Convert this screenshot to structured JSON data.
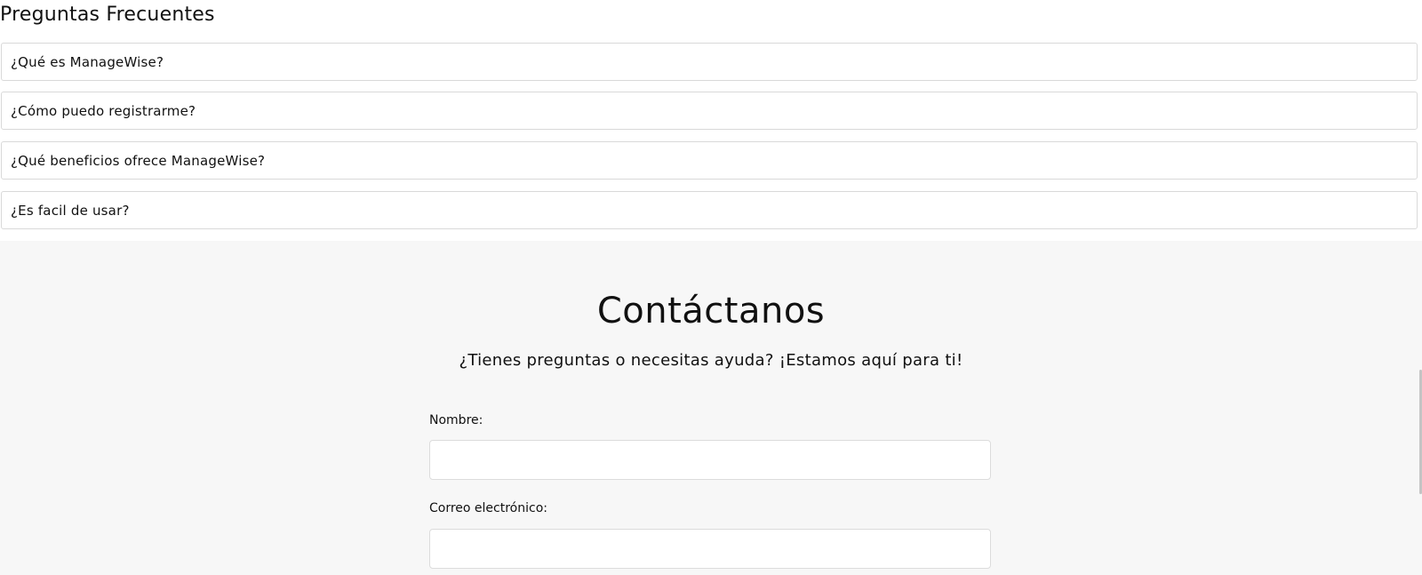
{
  "faq": {
    "title": "Preguntas Frecuentes",
    "items": [
      {
        "question": "¿Qué es ManageWise?"
      },
      {
        "question": "¿Cómo puedo registrarme?"
      },
      {
        "question": "¿Qué beneficios ofrece ManageWise?"
      },
      {
        "question": "¿Es facil de usar?"
      }
    ]
  },
  "contact": {
    "title": "Contáctanos",
    "subtitle": "¿Tienes preguntas o necesitas ayuda? ¡Estamos aquí para ti!",
    "name_label": "Nombre:",
    "name_value": "",
    "email_label": "Correo electrónico:",
    "email_value": ""
  }
}
